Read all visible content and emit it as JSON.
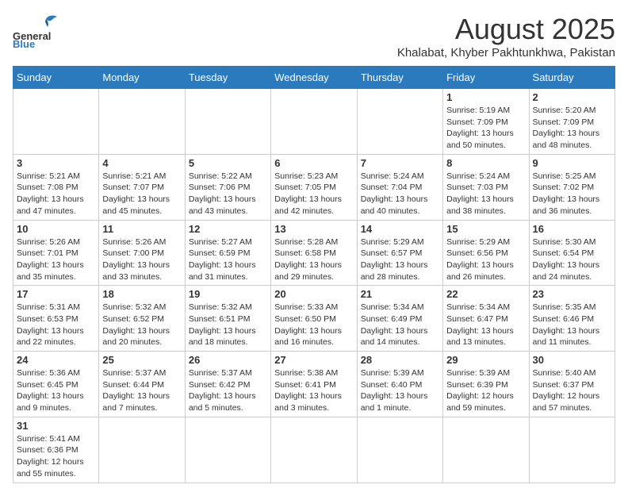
{
  "header": {
    "logo_general": "General",
    "logo_blue": "Blue",
    "month_year": "August 2025",
    "location": "Khalabat, Khyber Pakhtunkhwa, Pakistan"
  },
  "days_of_week": [
    "Sunday",
    "Monday",
    "Tuesday",
    "Wednesday",
    "Thursday",
    "Friday",
    "Saturday"
  ],
  "weeks": [
    [
      {
        "day": "",
        "info": ""
      },
      {
        "day": "",
        "info": ""
      },
      {
        "day": "",
        "info": ""
      },
      {
        "day": "",
        "info": ""
      },
      {
        "day": "",
        "info": ""
      },
      {
        "day": "1",
        "info": "Sunrise: 5:19 AM\nSunset: 7:09 PM\nDaylight: 13 hours and 50 minutes."
      },
      {
        "day": "2",
        "info": "Sunrise: 5:20 AM\nSunset: 7:09 PM\nDaylight: 13 hours and 48 minutes."
      }
    ],
    [
      {
        "day": "3",
        "info": "Sunrise: 5:21 AM\nSunset: 7:08 PM\nDaylight: 13 hours and 47 minutes."
      },
      {
        "day": "4",
        "info": "Sunrise: 5:21 AM\nSunset: 7:07 PM\nDaylight: 13 hours and 45 minutes."
      },
      {
        "day": "5",
        "info": "Sunrise: 5:22 AM\nSunset: 7:06 PM\nDaylight: 13 hours and 43 minutes."
      },
      {
        "day": "6",
        "info": "Sunrise: 5:23 AM\nSunset: 7:05 PM\nDaylight: 13 hours and 42 minutes."
      },
      {
        "day": "7",
        "info": "Sunrise: 5:24 AM\nSunset: 7:04 PM\nDaylight: 13 hours and 40 minutes."
      },
      {
        "day": "8",
        "info": "Sunrise: 5:24 AM\nSunset: 7:03 PM\nDaylight: 13 hours and 38 minutes."
      },
      {
        "day": "9",
        "info": "Sunrise: 5:25 AM\nSunset: 7:02 PM\nDaylight: 13 hours and 36 minutes."
      }
    ],
    [
      {
        "day": "10",
        "info": "Sunrise: 5:26 AM\nSunset: 7:01 PM\nDaylight: 13 hours and 35 minutes."
      },
      {
        "day": "11",
        "info": "Sunrise: 5:26 AM\nSunset: 7:00 PM\nDaylight: 13 hours and 33 minutes."
      },
      {
        "day": "12",
        "info": "Sunrise: 5:27 AM\nSunset: 6:59 PM\nDaylight: 13 hours and 31 minutes."
      },
      {
        "day": "13",
        "info": "Sunrise: 5:28 AM\nSunset: 6:58 PM\nDaylight: 13 hours and 29 minutes."
      },
      {
        "day": "14",
        "info": "Sunrise: 5:29 AM\nSunset: 6:57 PM\nDaylight: 13 hours and 28 minutes."
      },
      {
        "day": "15",
        "info": "Sunrise: 5:29 AM\nSunset: 6:56 PM\nDaylight: 13 hours and 26 minutes."
      },
      {
        "day": "16",
        "info": "Sunrise: 5:30 AM\nSunset: 6:54 PM\nDaylight: 13 hours and 24 minutes."
      }
    ],
    [
      {
        "day": "17",
        "info": "Sunrise: 5:31 AM\nSunset: 6:53 PM\nDaylight: 13 hours and 22 minutes."
      },
      {
        "day": "18",
        "info": "Sunrise: 5:32 AM\nSunset: 6:52 PM\nDaylight: 13 hours and 20 minutes."
      },
      {
        "day": "19",
        "info": "Sunrise: 5:32 AM\nSunset: 6:51 PM\nDaylight: 13 hours and 18 minutes."
      },
      {
        "day": "20",
        "info": "Sunrise: 5:33 AM\nSunset: 6:50 PM\nDaylight: 13 hours and 16 minutes."
      },
      {
        "day": "21",
        "info": "Sunrise: 5:34 AM\nSunset: 6:49 PM\nDaylight: 13 hours and 14 minutes."
      },
      {
        "day": "22",
        "info": "Sunrise: 5:34 AM\nSunset: 6:47 PM\nDaylight: 13 hours and 13 minutes."
      },
      {
        "day": "23",
        "info": "Sunrise: 5:35 AM\nSunset: 6:46 PM\nDaylight: 13 hours and 11 minutes."
      }
    ],
    [
      {
        "day": "24",
        "info": "Sunrise: 5:36 AM\nSunset: 6:45 PM\nDaylight: 13 hours and 9 minutes."
      },
      {
        "day": "25",
        "info": "Sunrise: 5:37 AM\nSunset: 6:44 PM\nDaylight: 13 hours and 7 minutes."
      },
      {
        "day": "26",
        "info": "Sunrise: 5:37 AM\nSunset: 6:42 PM\nDaylight: 13 hours and 5 minutes."
      },
      {
        "day": "27",
        "info": "Sunrise: 5:38 AM\nSunset: 6:41 PM\nDaylight: 13 hours and 3 minutes."
      },
      {
        "day": "28",
        "info": "Sunrise: 5:39 AM\nSunset: 6:40 PM\nDaylight: 13 hours and 1 minute."
      },
      {
        "day": "29",
        "info": "Sunrise: 5:39 AM\nSunset: 6:39 PM\nDaylight: 12 hours and 59 minutes."
      },
      {
        "day": "30",
        "info": "Sunrise: 5:40 AM\nSunset: 6:37 PM\nDaylight: 12 hours and 57 minutes."
      }
    ],
    [
      {
        "day": "31",
        "info": "Sunrise: 5:41 AM\nSunset: 6:36 PM\nDaylight: 12 hours and 55 minutes."
      },
      {
        "day": "",
        "info": ""
      },
      {
        "day": "",
        "info": ""
      },
      {
        "day": "",
        "info": ""
      },
      {
        "day": "",
        "info": ""
      },
      {
        "day": "",
        "info": ""
      },
      {
        "day": "",
        "info": ""
      }
    ]
  ]
}
